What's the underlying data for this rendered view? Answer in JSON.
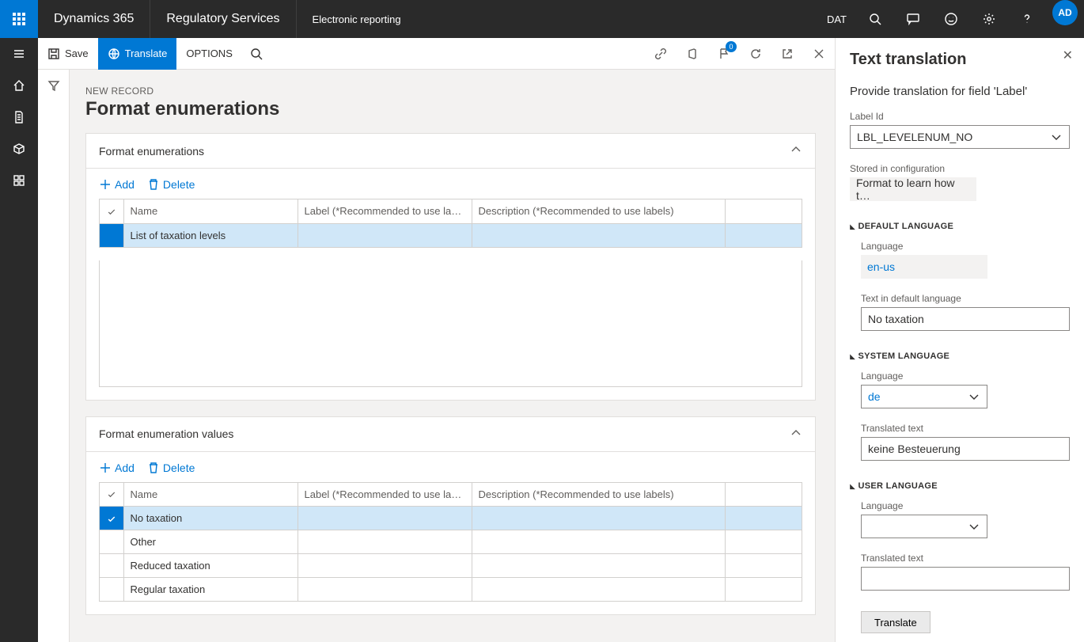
{
  "topbar": {
    "brand": "Dynamics 365",
    "service": "Regulatory Services",
    "crumb": "Electronic reporting",
    "company": "DAT",
    "avatar": "AD"
  },
  "actionbar": {
    "save": "Save",
    "translate": "Translate",
    "options": "OPTIONS",
    "badge": "0"
  },
  "page": {
    "newrec": "NEW RECORD",
    "title": "Format enumerations"
  },
  "card1": {
    "title": "Format enumerations",
    "add": "Add",
    "delete": "Delete",
    "columns": {
      "name": "Name",
      "label": "Label (*Recommended to use labels)",
      "desc": "Description (*Recommended to use labels)"
    },
    "rows": [
      {
        "name": "List of taxation levels",
        "label": "",
        "desc": ""
      }
    ]
  },
  "card2": {
    "title": "Format enumeration values",
    "add": "Add",
    "delete": "Delete",
    "columns": {
      "name": "Name",
      "label": "Label (*Recommended to use labels)",
      "desc": "Description (*Recommended to use labels)"
    },
    "rows": [
      {
        "name": "No taxation",
        "label": "",
        "desc": "",
        "selected": true
      },
      {
        "name": "Other",
        "label": "",
        "desc": ""
      },
      {
        "name": "Reduced taxation",
        "label": "",
        "desc": ""
      },
      {
        "name": "Regular taxation",
        "label": "",
        "desc": ""
      }
    ]
  },
  "pane": {
    "title": "Text translation",
    "subtitle": "Provide translation for field 'Label'",
    "labelid_label": "Label Id",
    "labelid_value": "LBL_LEVELENUM_NO",
    "stored_label": "Stored in configuration",
    "stored_value": "Format to learn how t…",
    "sec_default": "DEFAULT LANGUAGE",
    "lang_label": "Language",
    "default_lang": "en-us",
    "text_default_label": "Text in default language",
    "text_default_value": "No taxation",
    "sec_system": "SYSTEM LANGUAGE",
    "system_lang": "de",
    "translated_label": "Translated text",
    "translated_value": "keine Besteuerung",
    "sec_user": "USER LANGUAGE",
    "user_lang": "",
    "user_translated": "",
    "translate_btn": "Translate"
  }
}
